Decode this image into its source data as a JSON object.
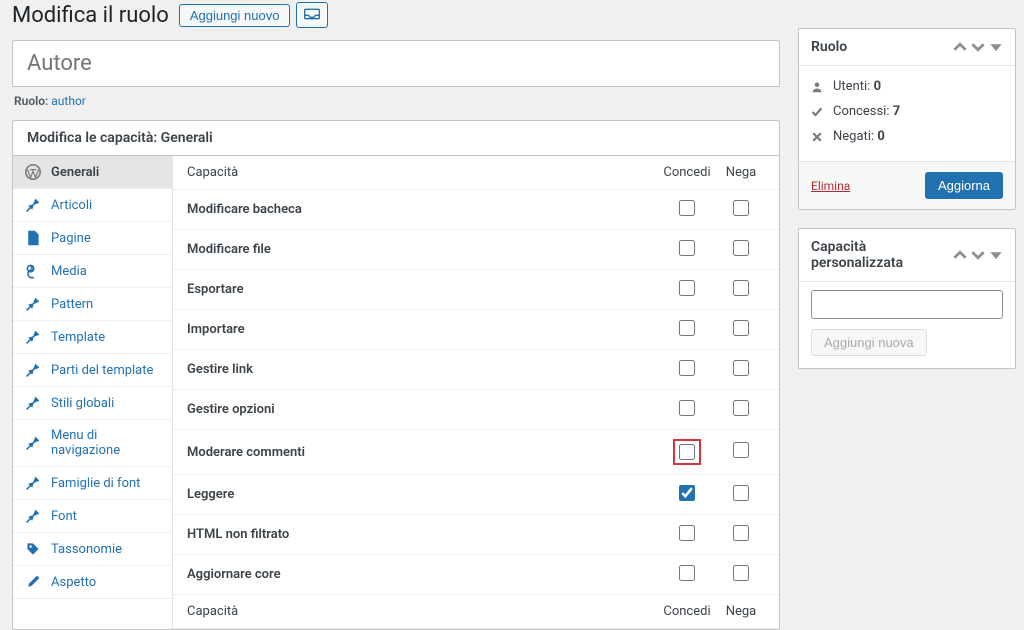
{
  "page": {
    "title": "Modifica il ruolo",
    "add_new_label": "Aggiungi nuovo",
    "role_title": "Autore",
    "role_slug_label": "Ruolo:",
    "role_slug": "author"
  },
  "cap_section": {
    "heading": "Modifica le capacità: Generali",
    "table_header_name": "Capacità",
    "table_header_grant": "Concedi",
    "table_header_deny": "Nega"
  },
  "nav_items": [
    {
      "label": "Generali",
      "icon": "wp"
    },
    {
      "label": "Articoli",
      "icon": "pin"
    },
    {
      "label": "Pagine",
      "icon": "page"
    },
    {
      "label": "Media",
      "icon": "media"
    },
    {
      "label": "Pattern",
      "icon": "pin"
    },
    {
      "label": "Template",
      "icon": "pin"
    },
    {
      "label": "Parti del template",
      "icon": "pin"
    },
    {
      "label": "Stili globali",
      "icon": "pin"
    },
    {
      "label": "Menu di navigazione",
      "icon": "pin"
    },
    {
      "label": "Famiglie di font",
      "icon": "pin"
    },
    {
      "label": "Font",
      "icon": "pin"
    },
    {
      "label": "Tassonomie",
      "icon": "tag"
    },
    {
      "label": "Aspetto",
      "icon": "brush"
    }
  ],
  "capabilities": [
    {
      "name": "Modificare bacheca",
      "grant": false,
      "deny": false,
      "highlight": false
    },
    {
      "name": "Modificare file",
      "grant": false,
      "deny": false,
      "highlight": false
    },
    {
      "name": "Esportare",
      "grant": false,
      "deny": false,
      "highlight": false
    },
    {
      "name": "Importare",
      "grant": false,
      "deny": false,
      "highlight": false
    },
    {
      "name": "Gestire link",
      "grant": false,
      "deny": false,
      "highlight": false
    },
    {
      "name": "Gestire opzioni",
      "grant": false,
      "deny": false,
      "highlight": false
    },
    {
      "name": "Moderare commenti",
      "grant": false,
      "deny": false,
      "highlight": true
    },
    {
      "name": "Leggere",
      "grant": true,
      "deny": false,
      "highlight": false
    },
    {
      "name": "HTML non filtrato",
      "grant": false,
      "deny": false,
      "highlight": false
    },
    {
      "name": "Aggiornare core",
      "grant": false,
      "deny": false,
      "highlight": false
    }
  ],
  "sidebar": {
    "role_panel": {
      "title": "Ruolo",
      "users_label": "Utenti:",
      "users_count": "0",
      "granted_label": "Concessi:",
      "granted_count": "7",
      "denied_label": "Negati:",
      "denied_count": "0",
      "delete_label": "Elimina",
      "update_label": "Aggiorna"
    },
    "custom_panel": {
      "title": "Capacità personalizzata",
      "add_label": "Aggiungi nuova"
    }
  }
}
